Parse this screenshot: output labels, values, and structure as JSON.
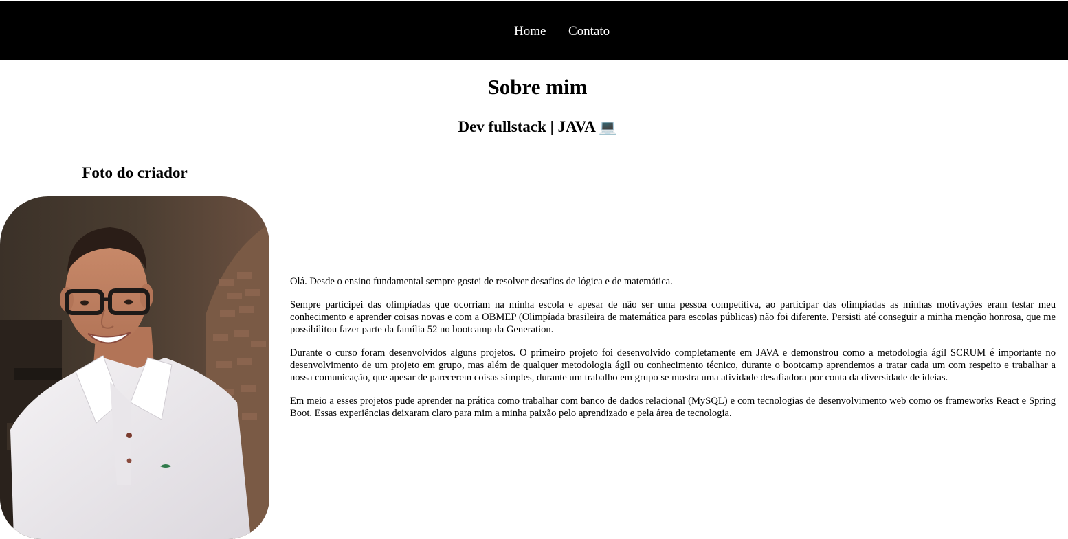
{
  "nav": {
    "home_label": "Home",
    "contact_label": "Contato"
  },
  "header": {
    "title": "Sobre mim",
    "subtitle": "Dev fullstack | JAVA",
    "subtitle_icon": "💻"
  },
  "photo_section": {
    "heading": "Foto do criador",
    "image_alt": "Foto do criador"
  },
  "about": {
    "paragraphs": [
      "Olá. Desde o ensino fundamental sempre gostei de resolver desafios de lógica e de matemática.",
      "Sempre participei das olimpíadas que ocorriam na minha escola e apesar de não ser uma pessoa competitiva, ao participar das olimpíadas as minhas motivações eram testar meu conhecimento e aprender coisas novas e com a OBMEP (Olimpíada brasileira de matemática para escolas públicas) não foi diferente. Persisti até conseguir a minha menção honrosa, que me possibilitou fazer parte da família 52 no bootcamp da Generation.",
      "Durante o curso foram desenvolvidos alguns projetos. O primeiro projeto foi desenvolvido completamente em JAVA e demonstrou como a metodologia ágil SCRUM é importante no desenvolvimento de um projeto em grupo, mas além de qualquer metodologia ágil ou conhecimento técnico, durante o bootcamp aprendemos a tratar cada um com respeito e trabalhar a nossa comunicação, que apesar de parecerem coisas simples, durante um trabalho em grupo se mostra uma atividade desafiadora por conta da diversidade de ideias.",
      "Em meio a esses projetos pude aprender na prática como trabalhar com banco de dados relacional (MySQL) e com tecnologias de desenvolvimento web como os frameworks React e Spring Boot. Essas experiências deixaram claro para mim a minha paixão pelo aprendizado e pela área de tecnologia."
    ]
  },
  "colors": {
    "navbar_bg": "#000000",
    "nav_text": "#ffffff",
    "page_bg": "#ffffff"
  }
}
